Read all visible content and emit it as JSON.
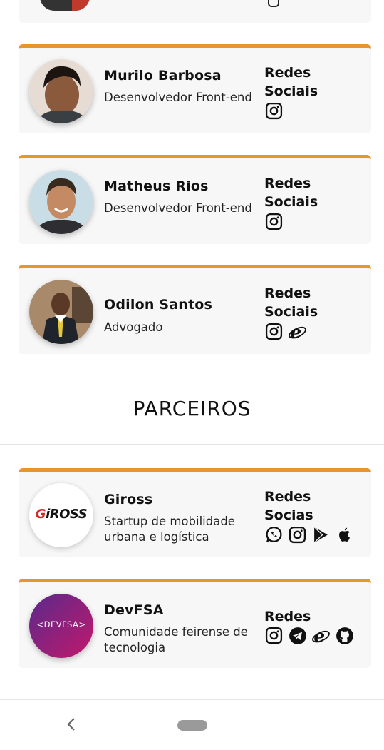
{
  "colors": {
    "accent": "#e8962c",
    "card_bg": "#f7f7f7"
  },
  "team": [
    {
      "name": "Murilo Barbosa",
      "role": "Desenvolvedor Front-end",
      "social_title": "Redes Sociais",
      "icons": [
        "instagram-icon"
      ]
    },
    {
      "name": "Matheus Rios",
      "role": "Desenvolvedor Front-end",
      "social_title": "Redes Sociais",
      "icons": [
        "instagram-icon"
      ]
    },
    {
      "name": "Odilon Santos",
      "role": "Advogado",
      "social_title": "Redes Sociais",
      "icons": [
        "instagram-icon",
        "internet-explorer-icon"
      ]
    }
  ],
  "partners_section": {
    "title": "PARCEIROS"
  },
  "partners": [
    {
      "name": "Giross",
      "logo_text": "GiROSS",
      "desc": "Startup de mobilidade urbana e logística",
      "social_title": "Redes Socias",
      "icons": [
        "whatsapp-icon",
        "instagram-icon",
        "google-play-icon",
        "apple-icon"
      ]
    },
    {
      "name": "DevFSA",
      "logo_text": "<DEVFSA>",
      "desc": "Comunidade feirense de tecnologia",
      "social_title": "Redes",
      "icons": [
        "instagram-icon",
        "telegram-icon",
        "internet-explorer-icon",
        "github-icon"
      ]
    }
  ],
  "navbar": {
    "back_icon": "chevron-left-icon",
    "home_icon": "home-pill-icon"
  }
}
